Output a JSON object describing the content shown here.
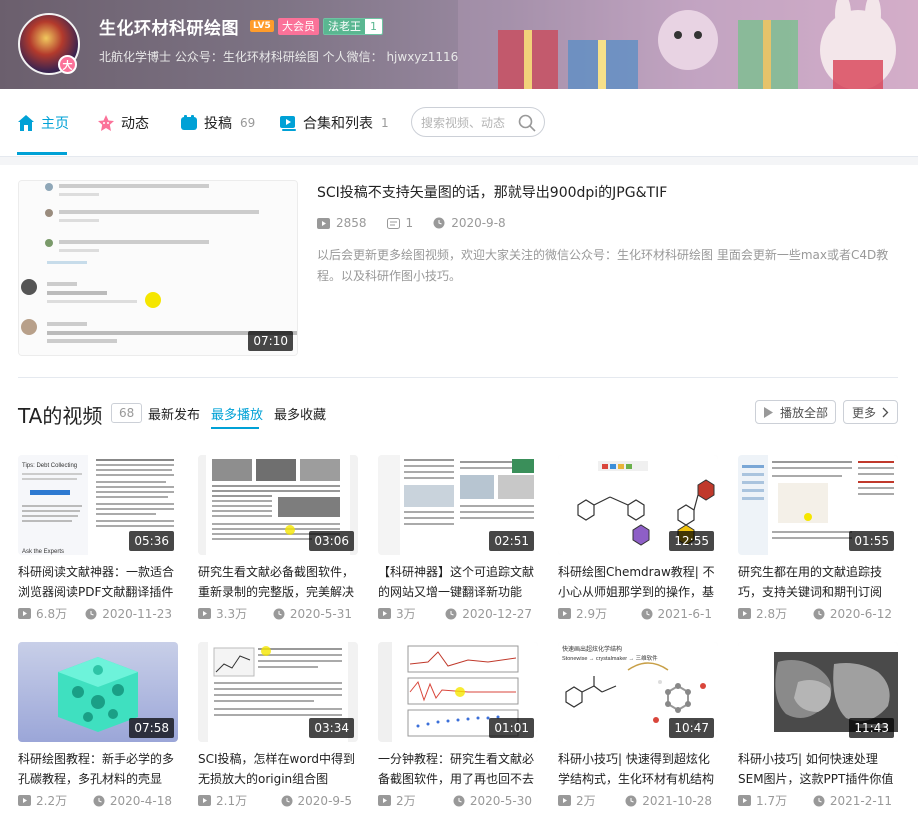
{
  "header": {
    "username": "生化环材科研绘图",
    "level": "LV5",
    "vip": "大会员",
    "medal": {
      "name": "法老王",
      "level": "1"
    },
    "sign": "北航化学博士 公众号：生化环材科研绘图 个人微信：  hjwxyz1116",
    "avatar_badge": "大"
  },
  "nav": {
    "items": [
      {
        "label": "主页",
        "count": "",
        "icon": "home-icon",
        "active": true
      },
      {
        "label": "动态",
        "count": "",
        "icon": "dynamic-icon",
        "active": false
      },
      {
        "label": "投稿",
        "count": "69",
        "icon": "upload-icon",
        "active": false
      },
      {
        "label": "合集和列表",
        "count": "1",
        "icon": "collection-icon",
        "active": false
      }
    ],
    "search_placeholder": "搜索视频、动态"
  },
  "featured": {
    "title": "SCI投稿不支持矢量图的话，那就导出900dpi的JPG&TIF",
    "plays": "2858",
    "danmaku": "1",
    "date": "2020-9-8",
    "description": "以后会更新更多绘图视频，欢迎大家关注的微信公众号：生化环材科研绘图 里面会更新一些max或者C4D教程。以及科研作图小技巧。",
    "duration": "07:10"
  },
  "videos_section": {
    "title": "TA的视频",
    "count": "68",
    "orders": [
      "最新发布",
      "最多播放",
      "最多收藏"
    ],
    "active_order": "最多播放",
    "play_all": "播放全部",
    "more": "更多"
  },
  "videos": [
    {
      "title": "科研阅读文献神器：一款适合浏览器阅读PDF文献翻译插件",
      "plays": "6.8万",
      "date": "2020-11-23",
      "duration": "05:36"
    },
    {
      "title": "研究生看文献必备截图软件，重新录制的完整版，完美解决",
      "plays": "3.3万",
      "date": "2020-5-31",
      "duration": "03:06"
    },
    {
      "title": "【科研神器】这个可追踪文献的网站又增一键翻译新功能",
      "plays": "3万",
      "date": "2020-12-27",
      "duration": "02:51"
    },
    {
      "title": "科研绘图Chemdraw教程| 不小心从师姐那学到的操作，基",
      "plays": "2.9万",
      "date": "2021-6-1",
      "duration": "12:55"
    },
    {
      "title": "研究生都在用的文献追踪技巧，支持关键词和期刊订阅",
      "plays": "2.8万",
      "date": "2020-6-12",
      "duration": "01:55"
    },
    {
      "title": "科研绘图教程：新手必学的多孔碳教程，多孔材料的壳显",
      "plays": "2.2万",
      "date": "2020-4-18",
      "duration": "07:58"
    },
    {
      "title": "SCI投稿，怎样在word中得到无损放大的origin组合图",
      "plays": "2.1万",
      "date": "2020-9-5",
      "duration": "03:34"
    },
    {
      "title": "一分钟教程：研究生看文献必备截图软件，用了再也回不去",
      "plays": "2万",
      "date": "2020-5-30",
      "duration": "01:01"
    },
    {
      "title": "科研小技巧| 快速得到超炫化学结构式，生化环材有机结构",
      "plays": "2万",
      "date": "2021-10-28",
      "duration": "10:47"
    },
    {
      "title": "科研小技巧| 如何快速处理SEM图片，这款PPT插件你值",
      "plays": "1.7万",
      "date": "2021-2-11",
      "duration": "11:43"
    }
  ],
  "thumb_texts": {
    "v1_heading": "Tips: Debt Collecting",
    "v1_footer": "Ask the Experts",
    "v9_line1": "快速画出超炫化学结构",
    "v9_line2": "Stonewise → crystalmaker → 三维软件"
  },
  "colors": {
    "accent": "#00a1d6",
    "vip": "#fb7299",
    "level": "#ff9c2b",
    "medal": "#5ab791"
  }
}
